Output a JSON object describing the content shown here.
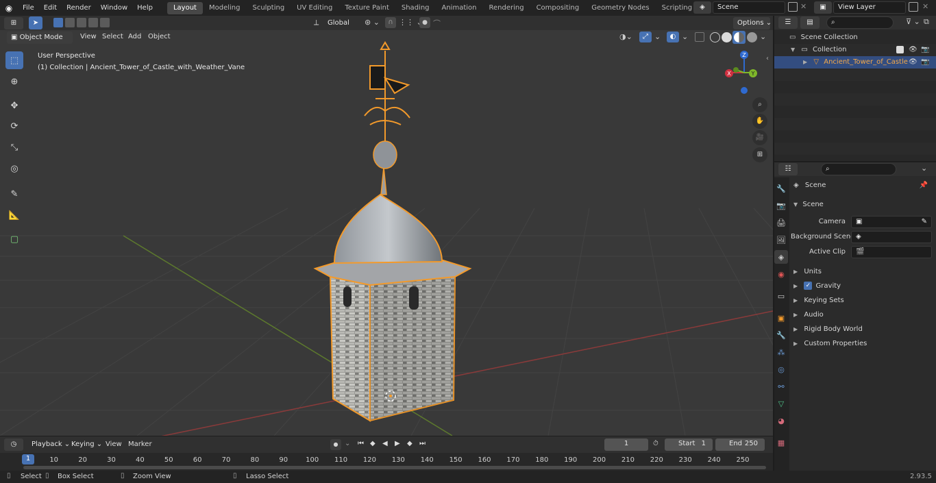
{
  "topbar": {
    "menus": [
      "File",
      "Edit",
      "Render",
      "Window",
      "Help"
    ],
    "workspaces": [
      "Layout",
      "Modeling",
      "Sculpting",
      "UV Editing",
      "Texture Paint",
      "Shading",
      "Animation",
      "Rendering",
      "Compositing",
      "Geometry Nodes",
      "Scripting"
    ],
    "active_workspace": "Layout",
    "scene_name": "Scene",
    "view_layer": "View Layer"
  },
  "viewport_header": {
    "mode": "Object Mode",
    "menus": [
      "View",
      "Select",
      "Add",
      "Object"
    ],
    "orientation": "Global",
    "options_label": "Options"
  },
  "viewport": {
    "perspective_label": "User Perspective",
    "collection_label": "(1) Collection | Ancient_Tower_of_Castle_with_Weather_Vane",
    "gizmo": {
      "x": "X",
      "y": "Y",
      "z": "Z"
    }
  },
  "outliner": {
    "scene_collection": "Scene Collection",
    "collection": "Collection",
    "object": "Ancient_Tower_of_Castle"
  },
  "properties": {
    "header_title": "Scene",
    "panel_title": "Scene",
    "fields": [
      {
        "label": "Camera"
      },
      {
        "label": "Background Scene"
      },
      {
        "label": "Active Clip"
      }
    ],
    "subpanels": [
      "Units",
      "Gravity",
      "Keying Sets",
      "Audio",
      "Rigid Body World",
      "Custom Properties"
    ],
    "gravity_checked": true
  },
  "timeline": {
    "menus": [
      "Playback",
      "Keying",
      "View",
      "Marker"
    ],
    "current_frame": "1",
    "start_label": "Start",
    "start_value": "1",
    "end_label": "End",
    "end_value": "250",
    "ticks": [
      "1",
      "10",
      "20",
      "30",
      "40",
      "50",
      "60",
      "70",
      "80",
      "90",
      "100",
      "110",
      "120",
      "130",
      "140",
      "150",
      "160",
      "170",
      "180",
      "190",
      "200",
      "210",
      "220",
      "230",
      "240",
      "250"
    ]
  },
  "statusbar": {
    "select": "Select",
    "box_select": "Box Select",
    "zoom_view": "Zoom View",
    "lasso_select": "Lasso Select",
    "version": "2.93.5"
  },
  "colors": {
    "accent": "#4772b3",
    "selection_orange": "#f39a2b",
    "viewport_bg": "#393939"
  }
}
